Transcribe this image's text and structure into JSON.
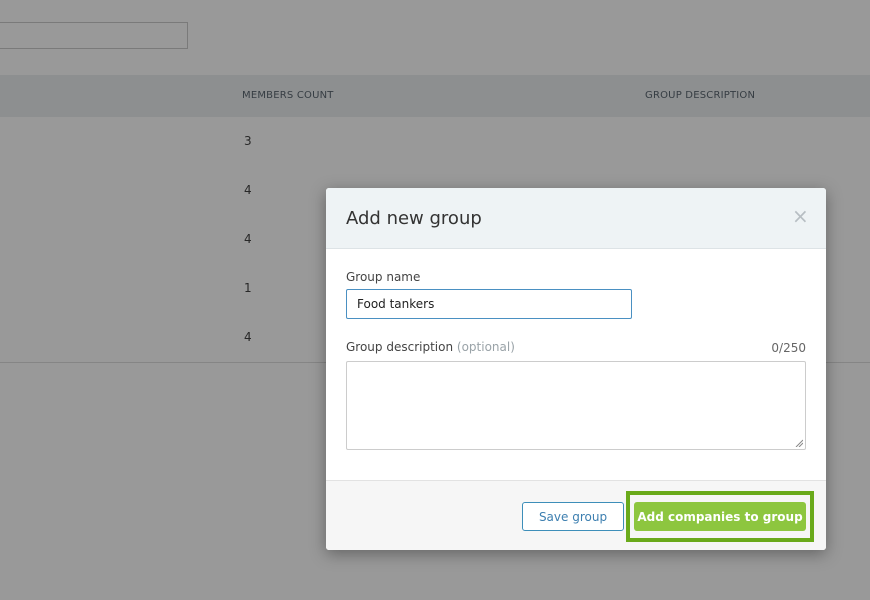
{
  "background": {
    "table": {
      "headers": [
        "MEMBERS COUNT",
        "GROUP DESCRIPTION"
      ],
      "rows": [
        {
          "members_count": "3"
        },
        {
          "members_count": "4"
        },
        {
          "members_count": "4"
        },
        {
          "members_count": "1"
        },
        {
          "members_count": "4"
        }
      ]
    }
  },
  "modal": {
    "title": "Add new group",
    "close_icon": "×",
    "group_name_label": "Group name",
    "group_name_value": "Food tankers",
    "description_label": "Group description",
    "description_optional": "(optional)",
    "description_value": "",
    "char_counter": "0/250",
    "save_button": "Save group",
    "add_companies_button": "Add companies to group"
  },
  "colors": {
    "accent_green": "#8dc63f",
    "highlight_green": "#6aaa1b",
    "link_blue": "#3d7fb0"
  }
}
